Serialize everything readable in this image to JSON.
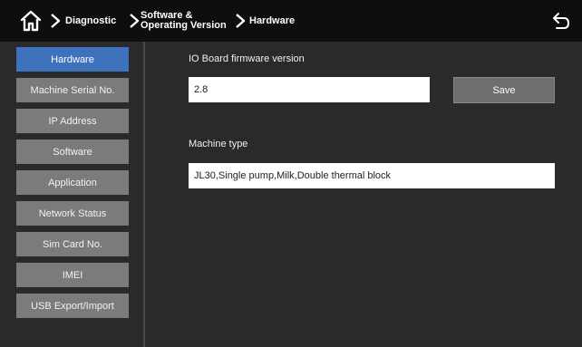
{
  "header": {
    "breadcrumbs": [
      {
        "label": "Diagnostic"
      },
      {
        "line1": "Software &",
        "line2": "Operating Version"
      },
      {
        "label": "Hardware"
      }
    ]
  },
  "sidebar": {
    "items": [
      {
        "label": "Hardware",
        "active": true
      },
      {
        "label": "Machine Serial No."
      },
      {
        "label": "IP Address"
      },
      {
        "label": "Software"
      },
      {
        "label": "Application"
      },
      {
        "label": "Network Status"
      },
      {
        "label": "Sim Card No."
      },
      {
        "label": "IMEI"
      },
      {
        "label": "USB Export/Import"
      }
    ]
  },
  "main": {
    "firmware": {
      "label": "IO Board firmware version",
      "value": "2.8",
      "save_label": "Save"
    },
    "machine_type": {
      "label": "Machine type",
      "value": "JL30,Single pump,Milk,Double thermal block"
    }
  },
  "colors": {
    "accent": "#3f72bd",
    "topbar": "#0e0e0f",
    "background": "#2a2a2c",
    "nav_item": "#7b7b7e"
  }
}
